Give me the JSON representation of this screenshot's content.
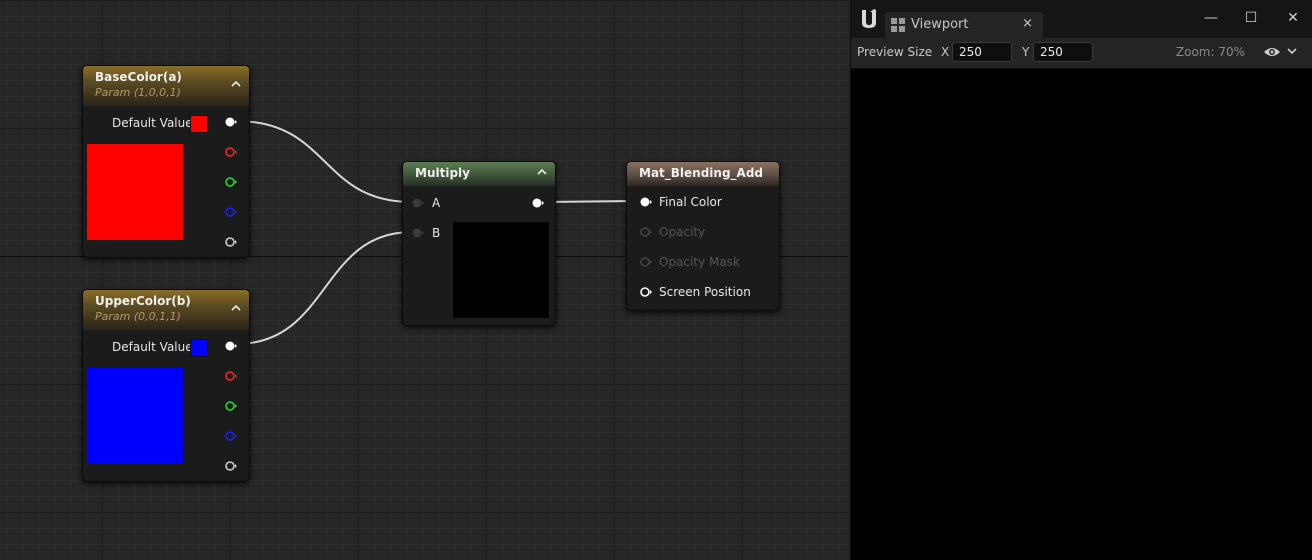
{
  "graph": {
    "nodes": {
      "base_color": {
        "title": "BaseColor(a)",
        "subtitle": "Param (1,0,0,1)",
        "default_label": "Default Value",
        "color": "#ff0000"
      },
      "upper_color": {
        "title": "UpperColor(b)",
        "subtitle": "Param (0,0,1,1)",
        "default_label": "Default Value",
        "color": "#0000ff"
      },
      "multiply": {
        "title": "Multiply",
        "pin_a": "A",
        "pin_b": "B",
        "preview_color": "#000000"
      },
      "material": {
        "title": "Mat_Blending_Add",
        "pins": [
          "Final Color",
          "Opacity",
          "Opacity Mask",
          "Screen Position"
        ]
      }
    },
    "channel_pin_colors": [
      "#ffffff",
      "#ff2020",
      "#20e020",
      "#2020ff",
      "#cccccc"
    ]
  },
  "viewport": {
    "tab_label": "Viewport",
    "tab_close": "×",
    "window_minimize": "—",
    "window_maximize": "☐",
    "window_close": "✕",
    "preview_size_label": "Preview Size",
    "x_label": "X",
    "x_value": "250",
    "y_label": "Y",
    "y_value": "250",
    "zoom_text": "Zoom: 70%",
    "eye_icon": "eye-icon",
    "dropdown_glyph": "⌄"
  }
}
